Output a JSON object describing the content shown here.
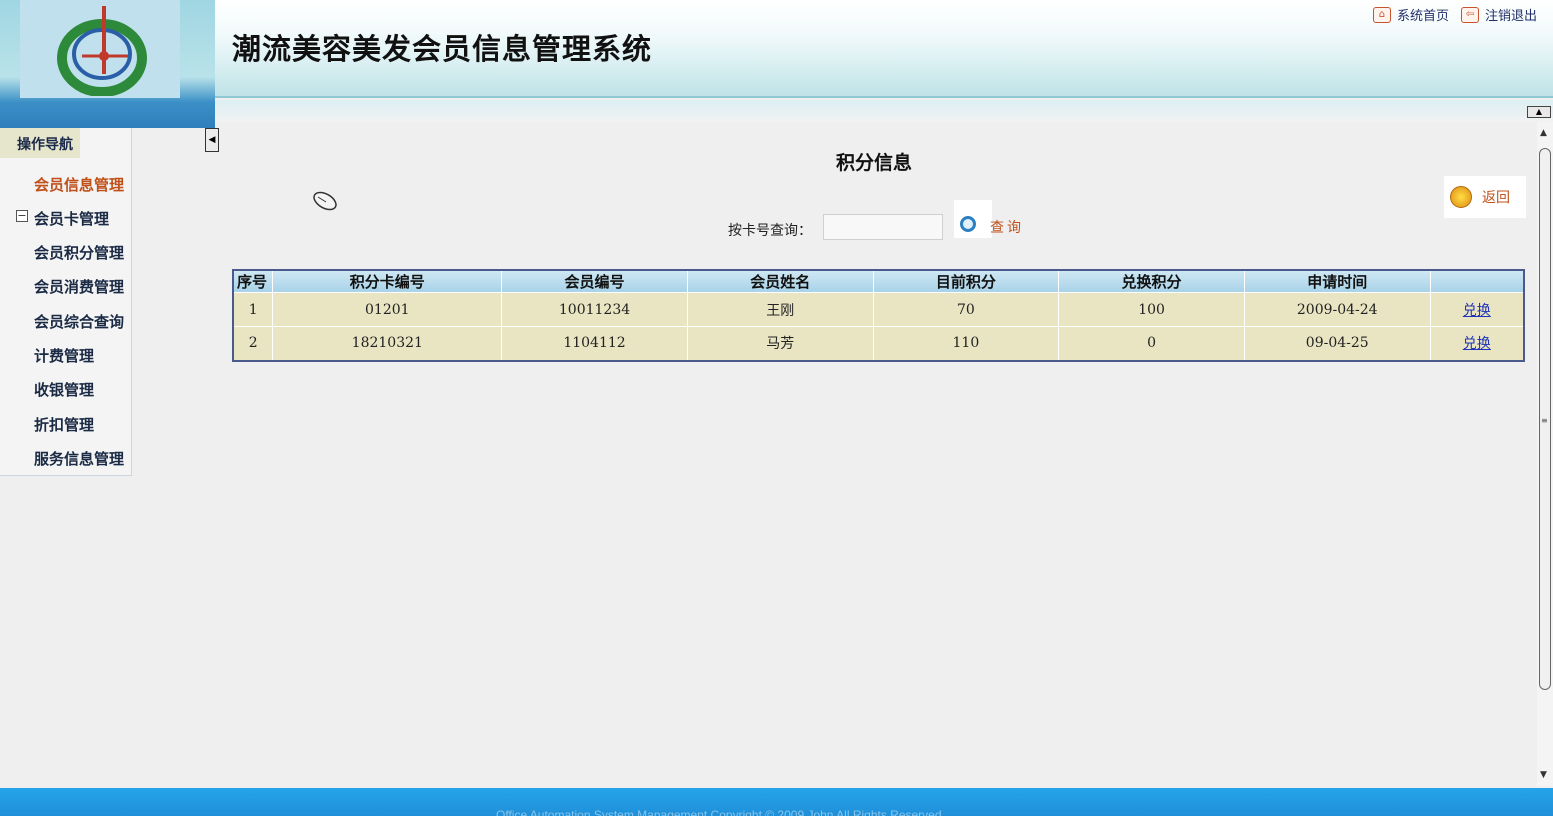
{
  "header": {
    "title": "潮流美容美发会员信息管理系统",
    "links": [
      {
        "icon": "home-icon",
        "label": "系统首页"
      },
      {
        "icon": "logout-icon",
        "label": "注销退出"
      }
    ]
  },
  "sidebar": {
    "heading": "操作导航",
    "items": [
      {
        "label": "会员信息管理",
        "active": true
      },
      {
        "label": "会员卡管理",
        "tree_toggle": "−"
      },
      {
        "label": "会员积分管理"
      },
      {
        "label": "会员消费管理"
      },
      {
        "label": "会员综合查询"
      },
      {
        "label": "计费管理"
      },
      {
        "label": "收银管理"
      },
      {
        "label": "折扣管理"
      },
      {
        "label": "服务信息管理"
      }
    ]
  },
  "main": {
    "title": "积分信息",
    "return_label": "返回",
    "search": {
      "label": "按卡号查询：",
      "value": "",
      "placeholder": "",
      "button_label": "查询"
    },
    "table": {
      "headers": [
        "序号",
        "积分卡编号",
        "会员编号",
        "会员姓名",
        "目前积分",
        "兑换积分",
        "申请时间",
        ""
      ],
      "rows": [
        {
          "index": "1",
          "card_no": "01201",
          "member_no": "10011234",
          "name": "王刚",
          "current_points": "70",
          "exchange_points": "100",
          "apply_time": "2009-04-24",
          "action": "兑换"
        },
        {
          "index": "2",
          "card_no": "18210321",
          "member_no": "1104112",
          "name": "马芳",
          "current_points": "110",
          "exchange_points": "0",
          "apply_time": "09-04-25",
          "action": "兑换"
        }
      ]
    }
  },
  "footer": {
    "text": "Office Automation System Management   Copyright © 2009  John All Rights Reserved"
  },
  "colors": {
    "accent_orange": "#c0501a",
    "link_blue": "#1f33b8",
    "footer_blue": "#25a4ea",
    "table_body": "#e9e5c3",
    "table_header": "#a8d3e8"
  }
}
